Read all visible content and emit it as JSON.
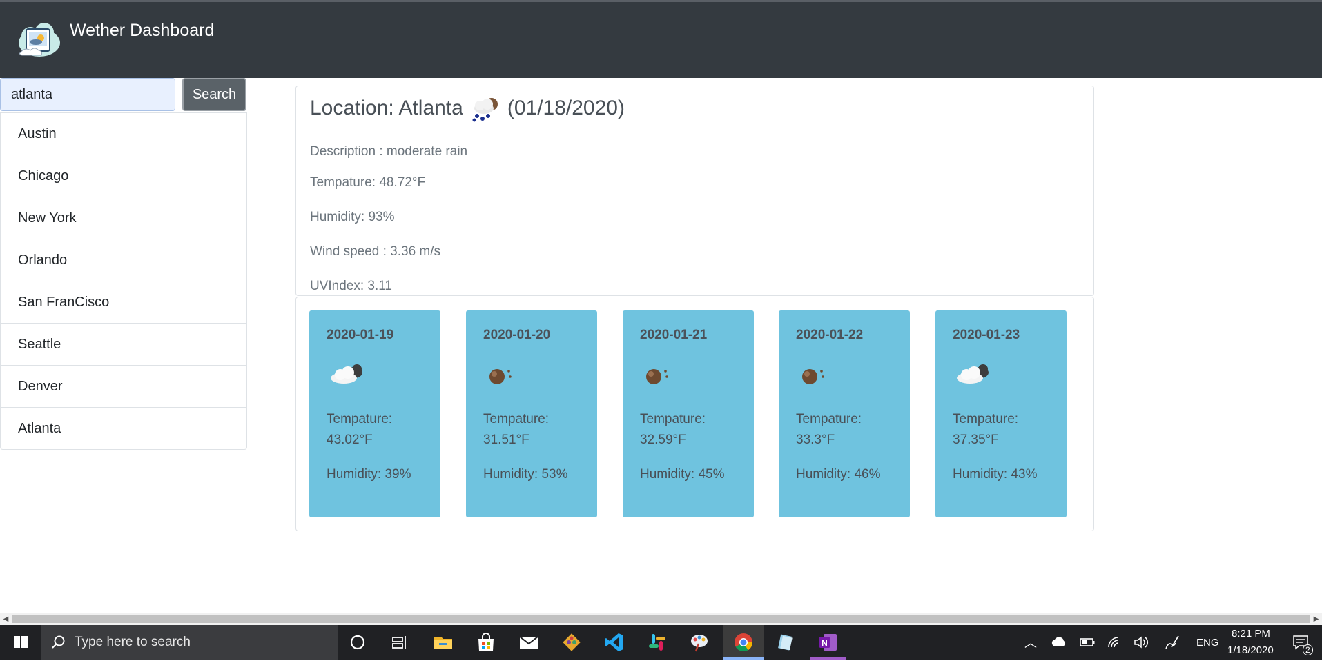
{
  "app": {
    "brand": "Wether Dashboard",
    "logo_icon": "weather-logo-icon"
  },
  "search": {
    "value": "atlanta",
    "button_label": "Search"
  },
  "cities": [
    "Austin",
    "Chicago",
    "New York",
    "Orlando",
    "San FranCisco",
    "Seattle",
    "Denver",
    "Atlanta"
  ],
  "current": {
    "location_prefix": "Location: Atlanta",
    "date": "(01/18/2020)",
    "icon": "rain-cloud-icon",
    "description": "Description : moderate rain",
    "temperature": "Tempature: 48.72°F",
    "humidity": "Humidity: 93%",
    "wind": "Wind speed : 3.36 m/s",
    "uv": "UVIndex: 3.11"
  },
  "forecast": [
    {
      "date": "2020-01-19",
      "icon": "cloud-icon",
      "temp_label": "Tempature:",
      "temp": "43.02°F",
      "humidity": "Humidity: 39%"
    },
    {
      "date": "2020-01-20",
      "icon": "sun-brown-icon",
      "temp_label": "Tempature:",
      "temp": "31.51°F",
      "humidity": "Humidity: 53%"
    },
    {
      "date": "2020-01-21",
      "icon": "sun-brown-icon",
      "temp_label": "Tempature:",
      "temp": "32.59°F",
      "humidity": "Humidity: 45%"
    },
    {
      "date": "2020-01-22",
      "icon": "sun-brown-icon",
      "temp_label": "Tempature:",
      "temp": "33.3°F",
      "humidity": "Humidity: 46%"
    },
    {
      "date": "2020-01-23",
      "icon": "cloud-icon",
      "temp_label": "Tempature:",
      "temp": "37.35°F",
      "humidity": "Humidity: 43%"
    }
  ],
  "taskbar": {
    "search_placeholder": "Type here to search",
    "language": "ENG",
    "time": "8:21 PM",
    "date": "1/18/2020",
    "notification_count": "2"
  },
  "colors": {
    "navbar": "#343a40",
    "forecast_card": "#6fc3df",
    "search_button": "#5a6268"
  }
}
